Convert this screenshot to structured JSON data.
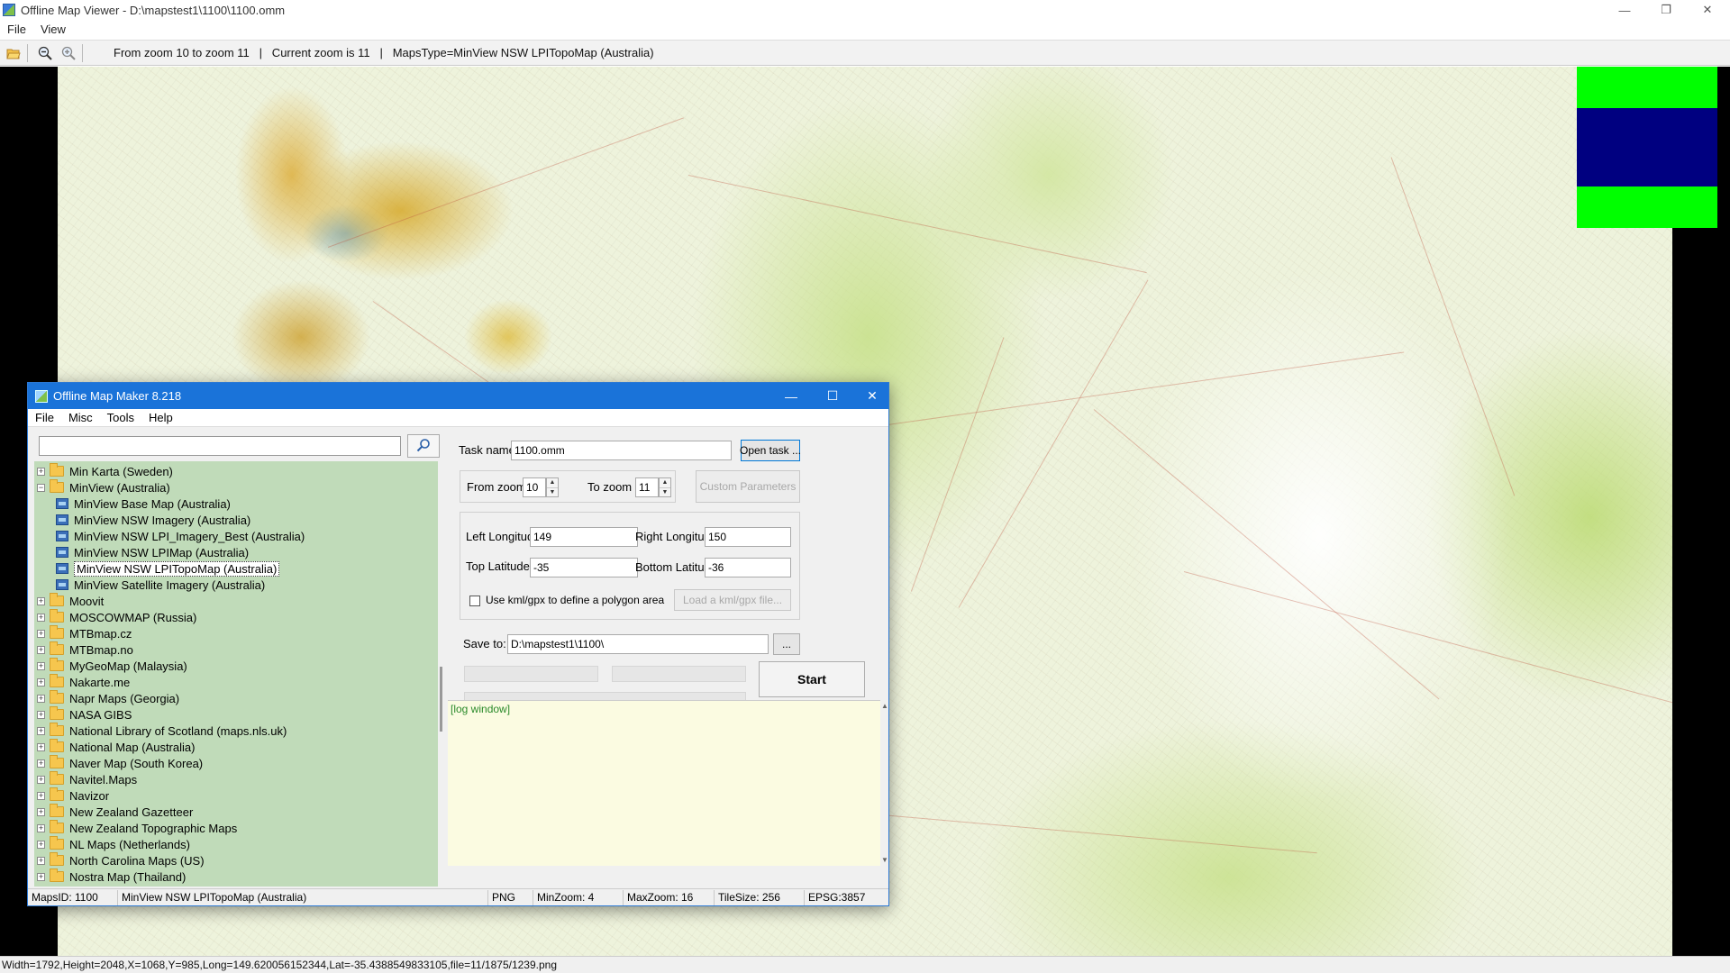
{
  "main_window": {
    "title": "Offline Map Viewer - D:\\mapstest1\\1100\\1100.omm",
    "menu": [
      "File",
      "View"
    ],
    "toolbar": {
      "icons": [
        "open-folder-icon",
        "zoom-out-icon",
        "zoom-in-icon"
      ],
      "status_text": "From zoom 10 to zoom 11   |   Current zoom is 11   |   MapsType=MinView NSW LPITopoMap (Australia)"
    },
    "status_bar": "Width=1792,Height=2048,X=1068,Y=985,Long=149.620056152344,Lat=-35.4388549833105,file=11/1875/1239.png",
    "colors": {
      "legend_green": "#00ff00",
      "legend_navy": "#000080"
    }
  },
  "dialog": {
    "title": "Offline Map Maker 8.218",
    "menu": [
      "File",
      "Misc",
      "Tools",
      "Help"
    ],
    "search": {
      "value": "",
      "placeholder": ""
    },
    "tree": [
      {
        "label": "Min Karta (Sweden)",
        "level": 0,
        "expanded": false,
        "selected": false
      },
      {
        "label": "MinView (Australia)",
        "level": 0,
        "expanded": true,
        "selected": false
      },
      {
        "label": "MinView Base Map (Australia)",
        "level": 1,
        "selected": false
      },
      {
        "label": "MinView NSW Imagery (Australia)",
        "level": 1,
        "selected": false
      },
      {
        "label": "MinView NSW LPI_Imagery_Best (Australia)",
        "level": 1,
        "selected": false
      },
      {
        "label": "MinView NSW LPIMap (Australia)",
        "level": 1,
        "selected": false
      },
      {
        "label": "MinView NSW LPITopoMap (Australia)",
        "level": 1,
        "selected": true
      },
      {
        "label": "MinView Satellite Imagery (Australia)",
        "level": 1,
        "selected": false
      },
      {
        "label": "Moovit",
        "level": 0,
        "expanded": false,
        "selected": false
      },
      {
        "label": "MOSCOWMAP (Russia)",
        "level": 0,
        "expanded": false,
        "selected": false
      },
      {
        "label": "MTBmap.cz",
        "level": 0,
        "expanded": false,
        "selected": false
      },
      {
        "label": "MTBmap.no",
        "level": 0,
        "expanded": false,
        "selected": false
      },
      {
        "label": "MyGeoMap (Malaysia)",
        "level": 0,
        "expanded": false,
        "selected": false
      },
      {
        "label": "Nakarte.me",
        "level": 0,
        "expanded": false,
        "selected": false
      },
      {
        "label": "Napr Maps (Georgia)",
        "level": 0,
        "expanded": false,
        "selected": false
      },
      {
        "label": "NASA GIBS",
        "level": 0,
        "expanded": false,
        "selected": false
      },
      {
        "label": "National Library of Scotland (maps.nls.uk)",
        "level": 0,
        "expanded": false,
        "selected": false
      },
      {
        "label": "National Map (Australia)",
        "level": 0,
        "expanded": false,
        "selected": false
      },
      {
        "label": "Naver Map (South Korea)",
        "level": 0,
        "expanded": false,
        "selected": false
      },
      {
        "label": "Navitel.Maps",
        "level": 0,
        "expanded": false,
        "selected": false
      },
      {
        "label": "Navizor",
        "level": 0,
        "expanded": false,
        "selected": false
      },
      {
        "label": "New Zealand Gazetteer",
        "level": 0,
        "expanded": false,
        "selected": false
      },
      {
        "label": "New Zealand Topographic Maps",
        "level": 0,
        "expanded": false,
        "selected": false
      },
      {
        "label": "NL Maps (Netherlands)",
        "level": 0,
        "expanded": false,
        "selected": false
      },
      {
        "label": "North Carolina Maps (US)",
        "level": 0,
        "expanded": false,
        "selected": false
      },
      {
        "label": "Nostra Map (Thailand)",
        "level": 0,
        "expanded": false,
        "selected": false
      }
    ],
    "task": {
      "task_name_label": "Task name",
      "task_name_value": "1100.omm",
      "open_task_label": "Open task ...",
      "from_zoom_label": "From zoom",
      "from_zoom_value": "10",
      "to_zoom_label": "To zoom",
      "to_zoom_value": "11",
      "custom_params_label": "Custom Parameters",
      "left_lon_label": "Left Longitude",
      "left_lon_value": "149",
      "right_lon_label": "Right Longitude",
      "right_lon_value": "150",
      "top_lat_label": "Top Latitude",
      "top_lat_value": "-35",
      "bottom_lat_label": "Bottom Latitude",
      "bottom_lat_value": "-36",
      "kml_checkbox_label": "Use kml/gpx to define a polygon area",
      "kml_checked": false,
      "load_kml_label": "Load a kml/gpx file...",
      "save_to_label": "Save to:",
      "save_to_value": "D:\\mapstest1\\1100\\",
      "browse_label": "...",
      "start_label": "Start",
      "progress": [
        0,
        0,
        0
      ]
    },
    "log_text": "[log window]",
    "status_bar": {
      "maps_id": "MapsID: 1100",
      "maps_name": "MinView NSW LPITopoMap (Australia)",
      "format": "PNG",
      "min_zoom": "MinZoom: 4",
      "max_zoom": "MaxZoom: 16",
      "tile_size": "TileSize: 256",
      "epsg": "EPSG:3857"
    }
  }
}
